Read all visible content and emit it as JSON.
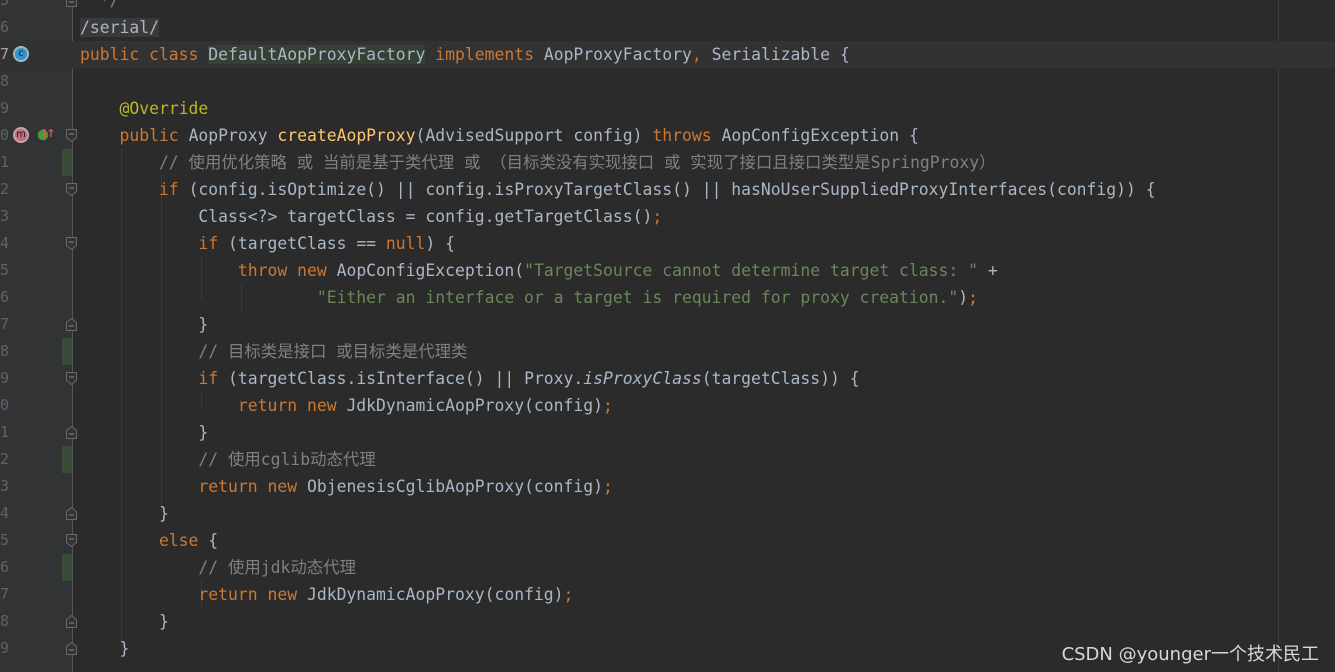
{
  "theme": {
    "background": "#2b2b2b",
    "gutter": "#313335",
    "keyword": "#cc7832",
    "text": "#a9b7c6",
    "comment": "#808080",
    "string": "#6a8759",
    "method_declaration": "#ffc66d",
    "annotation": "#bbb529"
  },
  "editor": {
    "current_line": 7,
    "changed_lines": [
      11,
      18,
      22,
      26
    ],
    "fold_lines": [
      5,
      10,
      12,
      14,
      17,
      19,
      21,
      24,
      25,
      28,
      29
    ],
    "gutter_icons": [
      {
        "line": 7,
        "icon": "class-implements-icon",
        "glyph": "c"
      },
      {
        "line": 10,
        "icon": "method-implements-icon",
        "glyph": "m"
      },
      {
        "line": 10,
        "icon": "implements-interface-method-icon",
        "glyph": "I↑"
      }
    ],
    "lines": [
      {
        "n": "5",
        "tokens": [
          {
            "t": "cm",
            "s": "  */"
          }
        ]
      },
      {
        "n": "6",
        "tokens": [
          {
            "t": "sel",
            "s": "/serial/"
          }
        ]
      },
      {
        "n": "7",
        "tokens": [
          {
            "t": "kw",
            "s": "public class "
          },
          {
            "t": "hl",
            "s": "DefaultAopProxyFactory"
          },
          {
            "t": "kw",
            "s": " implements "
          },
          {
            "t": "txt",
            "s": "AopProxyFactory"
          },
          {
            "t": "kw",
            "s": ", "
          },
          {
            "t": "txt",
            "s": "Serializable {"
          }
        ]
      },
      {
        "n": "8",
        "tokens": []
      },
      {
        "n": "9",
        "tokens": [
          {
            "t": "txt",
            "s": "    "
          },
          {
            "t": "an",
            "s": "@Override"
          }
        ]
      },
      {
        "n": "10",
        "tokens": [
          {
            "t": "kw",
            "s": "    public "
          },
          {
            "t": "txt",
            "s": "AopProxy "
          },
          {
            "t": "fn",
            "s": "createAopProxy"
          },
          {
            "t": "txt",
            "s": "(AdvisedSupport config) "
          },
          {
            "t": "kw",
            "s": "throws "
          },
          {
            "t": "txt",
            "s": "AopConfigException {"
          }
        ]
      },
      {
        "n": "11",
        "tokens": [
          {
            "t": "cm",
            "s": "        // 使用优化策略 或 当前是基于类代理 或 （目标类没有实现接口 或 实现了接口且接口类型是SpringProxy）"
          }
        ]
      },
      {
        "n": "12",
        "tokens": [
          {
            "t": "kw",
            "s": "        if "
          },
          {
            "t": "txt",
            "s": "(config.isOptimize() || config.isProxyTargetClass() || hasNoUserSuppliedProxyInterfaces(config)) {"
          }
        ]
      },
      {
        "n": "13",
        "tokens": [
          {
            "t": "txt",
            "s": "            Class<?> targetClass = config.getTargetClass()"
          },
          {
            "t": "kw",
            "s": ";"
          }
        ]
      },
      {
        "n": "14",
        "tokens": [
          {
            "t": "kw",
            "s": "            if "
          },
          {
            "t": "txt",
            "s": "(targetClass == "
          },
          {
            "t": "kw",
            "s": "null"
          },
          {
            "t": "txt",
            "s": ") {"
          }
        ]
      },
      {
        "n": "15",
        "tokens": [
          {
            "t": "kw",
            "s": "                throw new "
          },
          {
            "t": "txt",
            "s": "AopConfigException("
          },
          {
            "t": "str",
            "s": "\"TargetSource cannot determine target class: \" "
          },
          {
            "t": "txt",
            "s": "+"
          }
        ]
      },
      {
        "n": "16",
        "tokens": [
          {
            "t": "str",
            "s": "                        \"Either an interface or a target is required for proxy creation.\""
          },
          {
            "t": "txt",
            "s": ")"
          },
          {
            "t": "kw",
            "s": ";"
          }
        ]
      },
      {
        "n": "17",
        "tokens": [
          {
            "t": "txt",
            "s": "            }"
          }
        ]
      },
      {
        "n": "18",
        "tokens": [
          {
            "t": "cm",
            "s": "            // 目标类是接口 或目标类是代理类"
          }
        ]
      },
      {
        "n": "19",
        "tokens": [
          {
            "t": "kw",
            "s": "            if "
          },
          {
            "t": "txt",
            "s": "(targetClass.isInterface() || Proxy."
          },
          {
            "t": "it",
            "s": "isProxyClass"
          },
          {
            "t": "txt",
            "s": "(targetClass)) {"
          }
        ]
      },
      {
        "n": "20",
        "tokens": [
          {
            "t": "kw",
            "s": "                return new "
          },
          {
            "t": "txt",
            "s": "JdkDynamicAopProxy(config)"
          },
          {
            "t": "kw",
            "s": ";"
          }
        ]
      },
      {
        "n": "21",
        "tokens": [
          {
            "t": "txt",
            "s": "            }"
          }
        ]
      },
      {
        "n": "22",
        "tokens": [
          {
            "t": "cm",
            "s": "            // 使用cglib动态代理"
          }
        ]
      },
      {
        "n": "23",
        "tokens": [
          {
            "t": "kw",
            "s": "            return new "
          },
          {
            "t": "txt",
            "s": "ObjenesisCglibAopProxy(config)"
          },
          {
            "t": "kw",
            "s": ";"
          }
        ]
      },
      {
        "n": "24",
        "tokens": [
          {
            "t": "txt",
            "s": "        }"
          }
        ]
      },
      {
        "n": "25",
        "tokens": [
          {
            "t": "kw",
            "s": "        else "
          },
          {
            "t": "txt",
            "s": "{"
          }
        ]
      },
      {
        "n": "26",
        "tokens": [
          {
            "t": "cm",
            "s": "            // 使用jdk动态代理"
          }
        ]
      },
      {
        "n": "27",
        "tokens": [
          {
            "t": "kw",
            "s": "            return new "
          },
          {
            "t": "txt",
            "s": "JdkDynamicAopProxy(config)"
          },
          {
            "t": "kw",
            "s": ";"
          }
        ]
      },
      {
        "n": "28",
        "tokens": [
          {
            "t": "txt",
            "s": "        }"
          }
        ]
      },
      {
        "n": "29",
        "tokens": [
          {
            "t": "txt",
            "s": "    }"
          }
        ]
      }
    ]
  },
  "watermark": "CSDN @younger一个技术民工"
}
